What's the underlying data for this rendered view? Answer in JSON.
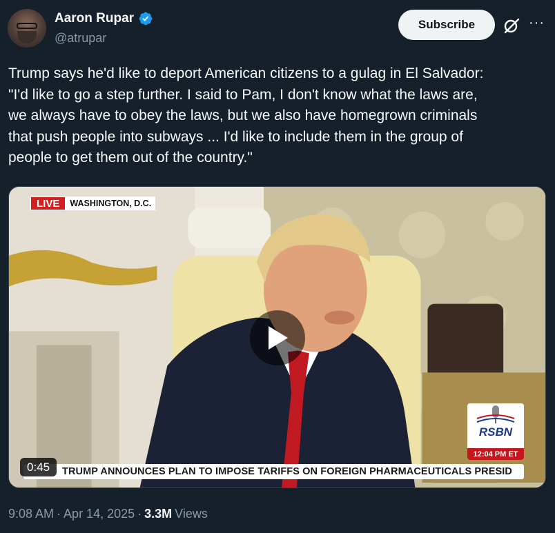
{
  "author": {
    "display_name": "Aaron Rupar",
    "handle": "@atrupar",
    "verified_icon": "verified-badge-icon"
  },
  "actions": {
    "subscribe_label": "Subscribe",
    "grok_icon": "grok-icon",
    "more_icon": "more-icon",
    "more_glyph": "···"
  },
  "tweet": {
    "text": "Trump says he'd like to deport American citizens to a gulag in El Salvador:\n\"I'd like to go a step further. I said to Pam, I don't know what the laws are,\nwe always have to obey the laws, but we also have homegrown criminals\nthat push people into subways ... I'd like to include them in the group of\npeople to get them out of the country.\""
  },
  "video": {
    "live_label": "LIVE",
    "location": "WASHINGTON, D.C.",
    "ticker": "TRUMP ANNOUNCES PLAN TO IMPOSE TARIFFS ON FOREIGN PHARMACEUTICALS     PRESID",
    "network_logo": "RSBN",
    "network_time": "12:04 PM ET",
    "duration": "0:45",
    "play_icon": "play-icon"
  },
  "meta": {
    "time": "9:08 AM",
    "separator": "·",
    "date": "Apr 14, 2025",
    "views_count": "3.3M",
    "views_label": "Views"
  },
  "colors": {
    "background": "#15202b",
    "text": "#f7f9f9",
    "secondary_text": "#8b98a5",
    "verified": "#1d9bf0",
    "live_red": "#d21f1f"
  }
}
